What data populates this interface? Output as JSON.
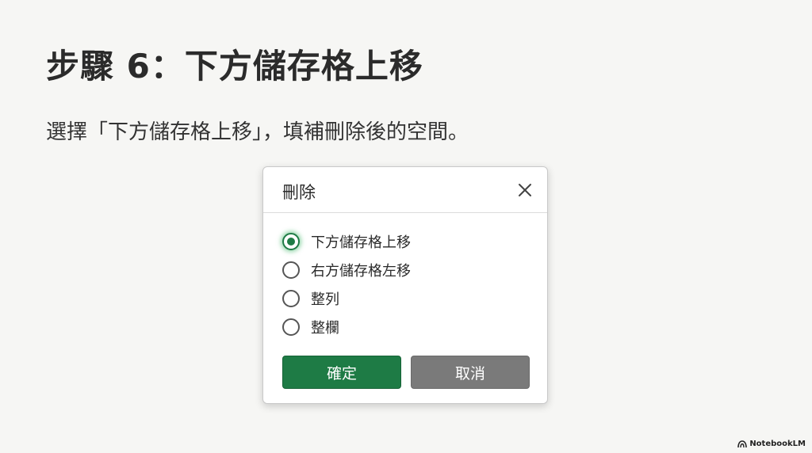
{
  "slide": {
    "title": "步驟 6：下方儲存格上移",
    "body": "選擇「下方儲存格上移」，填補刪除後的空間。"
  },
  "dialog": {
    "title": "刪除",
    "close_icon": "close-icon",
    "options": [
      {
        "label": "下方儲存格上移",
        "selected": true
      },
      {
        "label": "右方儲存格左移",
        "selected": false
      },
      {
        "label": "整列",
        "selected": false
      },
      {
        "label": "整欄",
        "selected": false
      }
    ],
    "ok_label": "確定",
    "cancel_label": "取消"
  },
  "colors": {
    "accent": "#1e7b45",
    "cancel": "#7a7a7a",
    "background": "#f6f6f4"
  },
  "watermark": {
    "text": "NotebookLM",
    "icon": "notebooklm-logo-icon"
  }
}
